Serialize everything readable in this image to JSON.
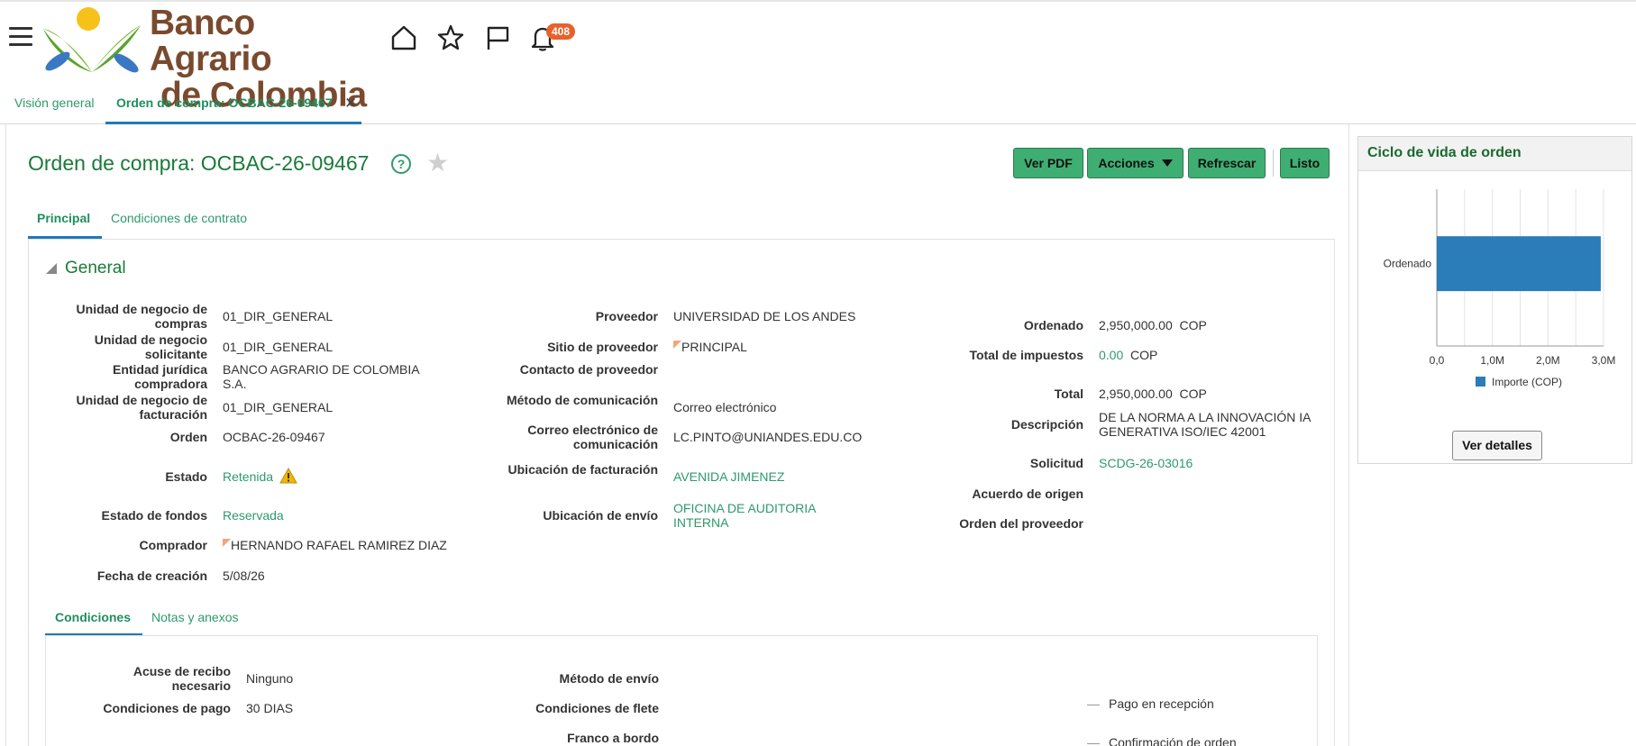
{
  "header": {
    "logo_line1": "Banco Agrario",
    "logo_line2": "de Colombia",
    "notification_count": "408"
  },
  "global_tabs": [
    {
      "label": "Visión general"
    },
    {
      "label": "Orden de compra: OCBAC-26-09467"
    }
  ],
  "page": {
    "title": "Orden de compra: OCBAC-26-09467",
    "buttons": {
      "pdf": "Ver PDF",
      "acciones": "Acciones",
      "refrescar": "Refrescar",
      "listo": "Listo"
    },
    "subtabs": [
      "Principal",
      "Condiciones de contrato"
    ],
    "section": "General"
  },
  "general": {
    "col1": [
      {
        "label": "Unidad de negocio de compras",
        "value": "01_DIR_GENERAL"
      },
      {
        "label": "Unidad de negocio solicitante",
        "value": "01_DIR_GENERAL"
      },
      {
        "label": "Entidad jurídica compradora",
        "value": "BANCO AGRARIO DE COLOMBIA S.A."
      },
      {
        "label": "Unidad de negocio de facturación",
        "value": "01_DIR_GENERAL"
      },
      {
        "label": "Orden",
        "value": "OCBAC-26-09467"
      },
      {
        "label": "Estado",
        "value": "Retenida"
      },
      {
        "label": "Estado de fondos",
        "value": "Reservada"
      },
      {
        "label": "Comprador",
        "value": "HERNANDO RAFAEL RAMIREZ DIAZ"
      },
      {
        "label": "Fecha de creación",
        "value": "5/08/26"
      }
    ],
    "col2": [
      {
        "label": "Proveedor",
        "value": "UNIVERSIDAD DE LOS ANDES"
      },
      {
        "label": "Sitio de proveedor",
        "value": "PRINCIPAL"
      },
      {
        "label": "Contacto de proveedor",
        "value": ""
      },
      {
        "label": "Método de comunicación",
        "value": "Correo electrónico"
      },
      {
        "label": "Correo electrónico de comunicación",
        "value": "LC.PINTO@UNIANDES.EDU.CO"
      },
      {
        "label": "Ubicación de facturación",
        "value": "AVENIDA JIMENEZ"
      },
      {
        "label": "Ubicación de envío",
        "value": "OFICINA DE AUDITORIA INTERNA"
      }
    ],
    "col3": [
      {
        "label": "Ordenado",
        "value": "2,950,000.00",
        "unit": "COP"
      },
      {
        "label": "Total de impuestos",
        "value": "0.00",
        "unit": "COP"
      },
      {
        "label": "Total",
        "value": "2,950,000.00",
        "unit": "COP"
      },
      {
        "label": "Descripción",
        "value": "DE LA NORMA A LA INNOVACIÓN IA GENERATIVA ISO/IEC 42001"
      },
      {
        "label": "Solicitud",
        "value": "SCDG-26-03016"
      },
      {
        "label": "Acuerdo de origen",
        "value": ""
      },
      {
        "label": "Orden del proveedor",
        "value": ""
      }
    ]
  },
  "conditions": {
    "tabs": [
      "Condiciones",
      "Notas y anexos"
    ],
    "rows": [
      {
        "label": "Acuse de recibo necesario",
        "value": "Ninguno"
      },
      {
        "label": "Condiciones de pago",
        "value": "30 DIAS"
      },
      {
        "label": "Método de envío",
        "value": ""
      },
      {
        "label": "Condiciones de flete",
        "value": ""
      },
      {
        "label": "Franco a bordo",
        "value": ""
      }
    ],
    "lifecycle_items": [
      "Pago en recepción",
      "Confirmación de orden"
    ]
  },
  "lifecycle": {
    "title": "Ciclo de vida de orden",
    "button": "Ver detalles"
  },
  "chart_data": {
    "type": "bar",
    "orientation": "horizontal",
    "categories": [
      "Ordenado"
    ],
    "series": [
      {
        "name": "Importe (COP)",
        "values": [
          2950000
        ]
      }
    ],
    "xlim": [
      0,
      3000000
    ],
    "xticks": [
      "0,0",
      "1,0M",
      "2,0M",
      "3,0M"
    ],
    "legend": "bottom",
    "grid": true,
    "color": "#2a7db8"
  }
}
